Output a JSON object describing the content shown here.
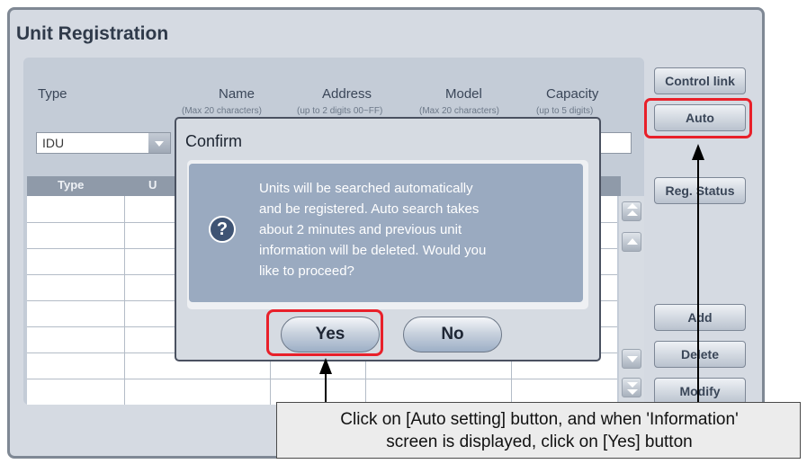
{
  "window": {
    "title": "Unit Registration"
  },
  "form": {
    "headers": {
      "type": "Type",
      "name": "Name",
      "name_hint": "(Max 20 characters)",
      "address": "Address",
      "address_hint": "(up to 2 digits 00~FF)",
      "model": "Model",
      "model_hint": "(Max 20 characters)",
      "capacity": "Capacity",
      "capacity_hint": "(up to 5 digits)"
    },
    "type_value": "IDU"
  },
  "table": {
    "col_type": "Type",
    "col_unit": "U"
  },
  "side_buttons": {
    "control_link": "Control link",
    "auto": "Auto",
    "reg_status": "Reg. Status",
    "add": "Add",
    "delete": "Delete",
    "modify": "Modify"
  },
  "dialog": {
    "title": "Confirm",
    "icon": "question-icon",
    "message_lines": [
      "Units will be searched automatically",
      "and be registered.  Auto search takes",
      "about 2 minutes and previous unit",
      "information will be deleted.  Would you",
      "like to proceed?"
    ],
    "yes_label": "Yes",
    "no_label": "No"
  },
  "callout": {
    "line1": "Click on [Auto setting] button, and when 'Information'",
    "line2": "screen is displayed, click on [Yes] button"
  },
  "colors": {
    "highlight": "#e8202a",
    "dialog_message_bg": "#9aaac0"
  }
}
